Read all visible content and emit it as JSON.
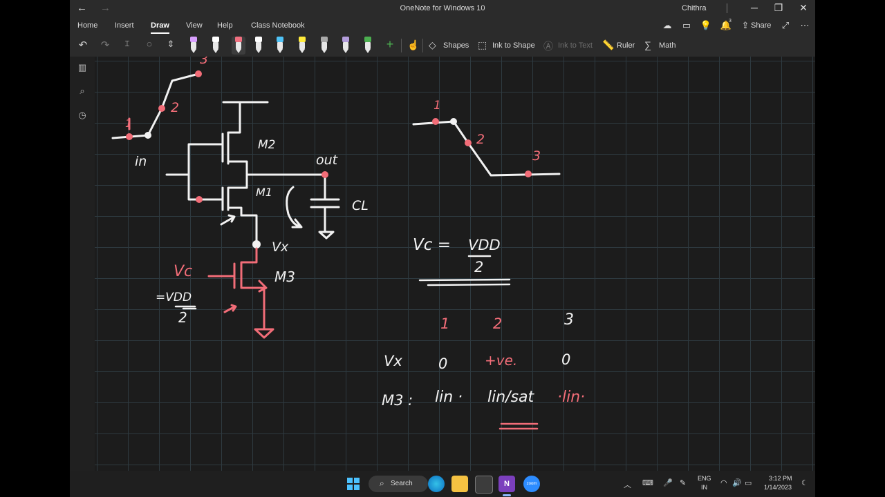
{
  "titlebar": {
    "title": "OneNote for Windows 10",
    "user": "Chithra"
  },
  "menu": {
    "tabs": [
      "Home",
      "Insert",
      "Draw",
      "View",
      "Help",
      "Class Notebook"
    ],
    "active": "Draw",
    "share_label": "Share",
    "notification_count": "3"
  },
  "toolbar": {
    "shapes_label": "Shapes",
    "ink_to_shape_label": "Ink to Shape",
    "ink_to_text_label": "Ink to Text",
    "ruler_label": "Ruler",
    "math_label": "Math",
    "pen_colors": [
      "#d9a0ff",
      "#ffffff",
      "#f07080",
      "#ffffff",
      "#4fc3f7",
      "#ffeb3b",
      "#aaaaaa",
      "#b39ddb",
      "#4caf50"
    ]
  },
  "ink": {
    "left_labels": {
      "p1": "1",
      "p2": "2",
      "p3": "3",
      "in": "in",
      "m2": "M2",
      "m1": "M1",
      "out": "out",
      "cl": "CL",
      "vx": "Vx",
      "m3": "M3",
      "vc": "Vc",
      "vdd_eq": "=VDD",
      "two": "2"
    },
    "right_labels": {
      "p1": "1",
      "p2": "2",
      "p3": "3"
    },
    "formula": {
      "lhs": "Vc =",
      "num": "VDD",
      "den": "2"
    },
    "table": {
      "headers": [
        "1",
        "2",
        "3"
      ],
      "rows": [
        {
          "label": "Vx",
          "values": [
            "0",
            "+ve.",
            "0"
          ]
        },
        {
          "label": "M3 :",
          "values": [
            "lin ·",
            "lin/sat",
            "·lin·"
          ]
        }
      ]
    }
  },
  "taskbar": {
    "search_label": "Search",
    "lang": "ENG",
    "region": "IN",
    "time": "3:12 PM",
    "date": "1/14/2023"
  },
  "colors": {
    "ink_white": "#f2f2f2",
    "ink_red": "#f26d78",
    "canvas_bg": "#1c1c1c"
  }
}
